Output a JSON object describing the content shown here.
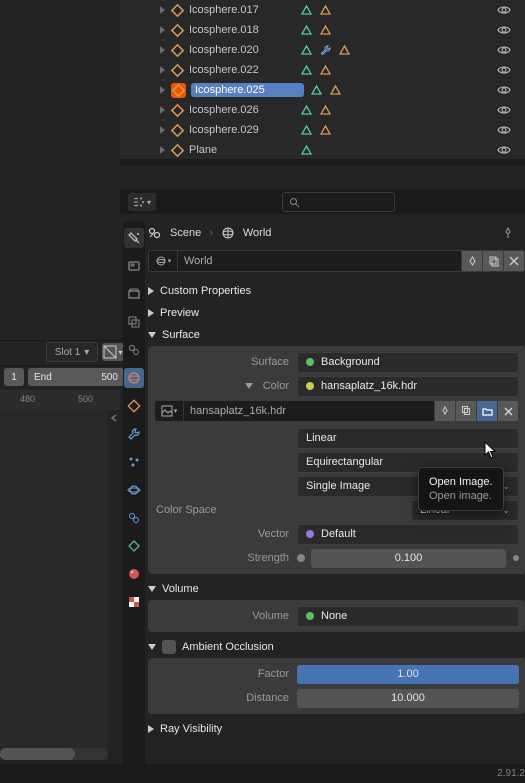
{
  "outliner": {
    "items": [
      {
        "label": "Icosphere.017",
        "selected": false,
        "extra": false
      },
      {
        "label": "Icosphere.018",
        "selected": false,
        "extra": false
      },
      {
        "label": "Icosphere.020",
        "selected": false,
        "extra": true
      },
      {
        "label": "Icosphere.022",
        "selected": false,
        "extra": false
      },
      {
        "label": "Icosphere.025",
        "selected": true,
        "extra": false
      },
      {
        "label": "Icosphere.026",
        "selected": false,
        "extra": false
      },
      {
        "label": "Icosphere.029",
        "selected": false,
        "extra": false
      },
      {
        "label": "Plane",
        "selected": false,
        "plane": true
      }
    ]
  },
  "timeline": {
    "slot": "Slot 1",
    "start": "1",
    "end_label": "End",
    "end": "500",
    "ruler_a": "480",
    "ruler_b": "500"
  },
  "breadcrumb": {
    "scene": "Scene",
    "world": "World"
  },
  "world_name": "World",
  "sections": {
    "custom": "Custom Properties",
    "preview": "Preview",
    "surface": "Surface",
    "volume": "Volume",
    "ao": "Ambient Occlusion",
    "ray": "Ray Visibility"
  },
  "surface": {
    "surface_label": "Surface",
    "surface_value": "Background",
    "color_label": "Color",
    "color_value": "hansaplatz_16k.hdr",
    "image_name": "hansaplatz_16k.hdr",
    "interp": "Linear",
    "projection": "Equirectangular",
    "source": "Single Image",
    "cs_label": "Color Space",
    "cs_value": "Linear",
    "vector_label": "Vector",
    "vector_value": "Default",
    "strength_label": "Strength",
    "strength_value": "0.100"
  },
  "volume": {
    "label": "Volume",
    "value": "None"
  },
  "ao": {
    "factor_label": "Factor",
    "factor_value": "1.00",
    "distance_label": "Distance",
    "distance_value": "10.000"
  },
  "tooltip": {
    "title": "Open Image.",
    "desc": "Open image."
  },
  "version": "2.91.2"
}
